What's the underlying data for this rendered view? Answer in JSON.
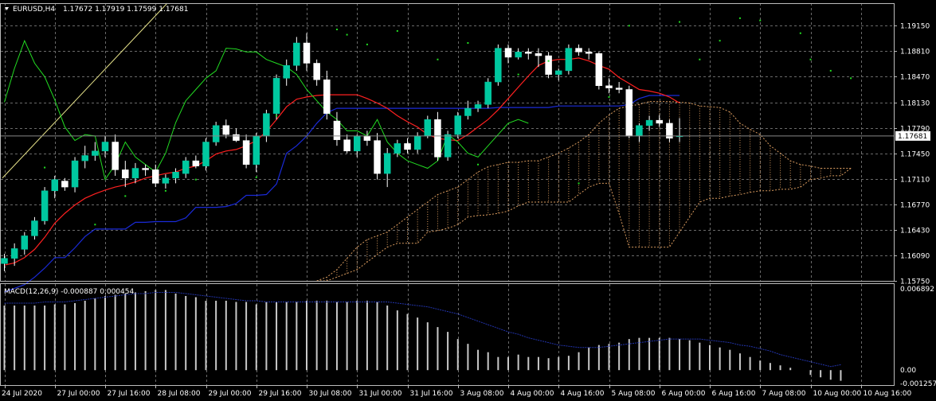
{
  "colors": {
    "background": "#000000",
    "grid": "#6a6a6a",
    "text": "#ffffff",
    "bull": "#00c8a0",
    "bear": "#ffffff",
    "tenkan": "#ff2020",
    "kijun": "#1a2ad8",
    "chikou": "#22dd22",
    "cloud": "#d89a5e",
    "trendline": "#e6e28a",
    "macd_hist": "#c8c8c8",
    "macd_signal": "#2233aa",
    "price_marker_bg": "#ffffff",
    "price_marker_text": "#000000"
  },
  "main_header": {
    "symbol": "EURUSD,H4",
    "ohlc": "1.17672 1.17919 1.17599 1.17681"
  },
  "macd_header": {
    "label": "MACD(12,26,9) -0.000887 0.000454"
  },
  "current_price_label": "1.17681",
  "chart_data": [
    {
      "type": "candlestick",
      "ylim": [
        1.1575,
        1.1945
      ],
      "y_ticks": [
        "1.19150",
        "1.18810",
        "1.18470",
        "1.18130",
        "1.17790",
        "1.17450",
        "1.17110",
        "1.16770",
        "1.16430",
        "1.16090",
        "1.15750"
      ],
      "y_tick_values": [
        1.1915,
        1.1881,
        1.1847,
        1.1813,
        1.1779,
        1.1745,
        1.1711,
        1.1677,
        1.1643,
        1.1609,
        1.1575
      ],
      "x_labels": [
        "24 Jul 2020",
        "27 Jul 00:00",
        "27 Jul 16:00",
        "28 Jul 08:00",
        "29 Jul 00:00",
        "29 Jul 16:00",
        "30 Jul 08:00",
        "31 Jul 00:00",
        "31 Jul 16:00",
        "3 Aug 08:00",
        "4 Aug 00:00",
        "4 Aug 16:00",
        "5 Aug 08:00",
        "6 Aug 00:00",
        "6 Aug 16:00",
        "7 Aug 08:00",
        "10 Aug 00:00",
        "10 Aug 16:00"
      ],
      "x_label_bars": [
        0,
        5,
        10,
        15,
        20,
        25,
        30,
        35,
        40,
        45,
        50,
        55,
        60,
        65,
        70,
        75,
        80,
        85
      ],
      "current_price": 1.17681,
      "candles": [
        {
          "o": 1.1598,
          "h": 1.1611,
          "l": 1.1588,
          "c": 1.1605
        },
        {
          "o": 1.1605,
          "h": 1.1625,
          "l": 1.1595,
          "c": 1.1618
        },
        {
          "o": 1.1617,
          "h": 1.164,
          "l": 1.161,
          "c": 1.1635
        },
        {
          "o": 1.1635,
          "h": 1.166,
          "l": 1.163,
          "c": 1.1655
        },
        {
          "o": 1.1655,
          "h": 1.17,
          "l": 1.165,
          "c": 1.1695
        },
        {
          "o": 1.1695,
          "h": 1.1715,
          "l": 1.1685,
          "c": 1.171
        },
        {
          "o": 1.1708,
          "h": 1.1712,
          "l": 1.1695,
          "c": 1.17
        },
        {
          "o": 1.17,
          "h": 1.174,
          "l": 1.1693,
          "c": 1.1735
        },
        {
          "o": 1.1735,
          "h": 1.1755,
          "l": 1.1725,
          "c": 1.1742
        },
        {
          "o": 1.1742,
          "h": 1.176,
          "l": 1.1735,
          "c": 1.1748
        },
        {
          "o": 1.1748,
          "h": 1.1768,
          "l": 1.174,
          "c": 1.176
        },
        {
          "o": 1.176,
          "h": 1.177,
          "l": 1.1715,
          "c": 1.1723
        },
        {
          "o": 1.1723,
          "h": 1.1735,
          "l": 1.17,
          "c": 1.1712
        },
        {
          "o": 1.1712,
          "h": 1.1732,
          "l": 1.1705,
          "c": 1.1725
        },
        {
          "o": 1.1725,
          "h": 1.173,
          "l": 1.1715,
          "c": 1.1723
        },
        {
          "o": 1.1723,
          "h": 1.173,
          "l": 1.17,
          "c": 1.1705
        },
        {
          "o": 1.1705,
          "h": 1.1717,
          "l": 1.1698,
          "c": 1.1712
        },
        {
          "o": 1.1712,
          "h": 1.1725,
          "l": 1.1705,
          "c": 1.172
        },
        {
          "o": 1.1718,
          "h": 1.174,
          "l": 1.1712,
          "c": 1.1735
        },
        {
          "o": 1.1735,
          "h": 1.1742,
          "l": 1.1725,
          "c": 1.1728
        },
        {
          "o": 1.1728,
          "h": 1.1765,
          "l": 1.1722,
          "c": 1.176
        },
        {
          "o": 1.176,
          "h": 1.1787,
          "l": 1.1755,
          "c": 1.1782
        },
        {
          "o": 1.1782,
          "h": 1.179,
          "l": 1.1765,
          "c": 1.177
        },
        {
          "o": 1.177,
          "h": 1.1778,
          "l": 1.176,
          "c": 1.1762
        },
        {
          "o": 1.1762,
          "h": 1.177,
          "l": 1.1725,
          "c": 1.173
        },
        {
          "o": 1.173,
          "h": 1.1772,
          "l": 1.172,
          "c": 1.1768
        },
        {
          "o": 1.1768,
          "h": 1.1803,
          "l": 1.176,
          "c": 1.1798
        },
        {
          "o": 1.1798,
          "h": 1.185,
          "l": 1.179,
          "c": 1.1845
        },
        {
          "o": 1.1845,
          "h": 1.187,
          "l": 1.1835,
          "c": 1.1862
        },
        {
          "o": 1.1862,
          "h": 1.19,
          "l": 1.1855,
          "c": 1.1892
        },
        {
          "o": 1.1892,
          "h": 1.1905,
          "l": 1.1855,
          "c": 1.1865
        },
        {
          "o": 1.1865,
          "h": 1.187,
          "l": 1.1835,
          "c": 1.1843
        },
        {
          "o": 1.1843,
          "h": 1.1855,
          "l": 1.179,
          "c": 1.1798
        },
        {
          "o": 1.1788,
          "h": 1.18,
          "l": 1.1755,
          "c": 1.1763
        },
        {
          "o": 1.1763,
          "h": 1.177,
          "l": 1.1745,
          "c": 1.1748
        },
        {
          "o": 1.1748,
          "h": 1.177,
          "l": 1.174,
          "c": 1.1768
        },
        {
          "o": 1.1768,
          "h": 1.1775,
          "l": 1.1755,
          "c": 1.1762
        },
        {
          "o": 1.1762,
          "h": 1.1772,
          "l": 1.171,
          "c": 1.1718
        },
        {
          "o": 1.1718,
          "h": 1.1752,
          "l": 1.17,
          "c": 1.1745
        },
        {
          "o": 1.1745,
          "h": 1.1763,
          "l": 1.174,
          "c": 1.1758
        },
        {
          "o": 1.1758,
          "h": 1.1765,
          "l": 1.1745,
          "c": 1.175
        },
        {
          "o": 1.175,
          "h": 1.1773,
          "l": 1.1745,
          "c": 1.1768
        },
        {
          "o": 1.1768,
          "h": 1.1795,
          "l": 1.1765,
          "c": 1.179
        },
        {
          "o": 1.179,
          "h": 1.18,
          "l": 1.1735,
          "c": 1.174
        },
        {
          "o": 1.174,
          "h": 1.1775,
          "l": 1.1735,
          "c": 1.177
        },
        {
          "o": 1.177,
          "h": 1.18,
          "l": 1.1765,
          "c": 1.1795
        },
        {
          "o": 1.1795,
          "h": 1.1815,
          "l": 1.179,
          "c": 1.1805
        },
        {
          "o": 1.1805,
          "h": 1.1815,
          "l": 1.18,
          "c": 1.181
        },
        {
          "o": 1.181,
          "h": 1.1845,
          "l": 1.1805,
          "c": 1.184
        },
        {
          "o": 1.184,
          "h": 1.189,
          "l": 1.1835,
          "c": 1.1885
        },
        {
          "o": 1.1885,
          "h": 1.189,
          "l": 1.1865,
          "c": 1.1873
        },
        {
          "o": 1.1873,
          "h": 1.1885,
          "l": 1.187,
          "c": 1.188
        },
        {
          "o": 1.188,
          "h": 1.1885,
          "l": 1.187,
          "c": 1.1878
        },
        {
          "o": 1.1878,
          "h": 1.1885,
          "l": 1.186,
          "c": 1.1875
        },
        {
          "o": 1.1875,
          "h": 1.188,
          "l": 1.1845,
          "c": 1.185
        },
        {
          "o": 1.185,
          "h": 1.1858,
          "l": 1.1842,
          "c": 1.1855
        },
        {
          "o": 1.1855,
          "h": 1.189,
          "l": 1.185,
          "c": 1.1885
        },
        {
          "o": 1.1885,
          "h": 1.189,
          "l": 1.1875,
          "c": 1.188
        },
        {
          "o": 1.188,
          "h": 1.1885,
          "l": 1.187,
          "c": 1.1878
        },
        {
          "o": 1.1878,
          "h": 1.188,
          "l": 1.183,
          "c": 1.1835
        },
        {
          "o": 1.1835,
          "h": 1.1845,
          "l": 1.1825,
          "c": 1.1832
        },
        {
          "o": 1.1832,
          "h": 1.184,
          "l": 1.1825,
          "c": 1.183
        },
        {
          "o": 1.183,
          "h": 1.1835,
          "l": 1.1765,
          "c": 1.1768
        },
        {
          "o": 1.1768,
          "h": 1.1785,
          "l": 1.176,
          "c": 1.1782
        },
        {
          "o": 1.1782,
          "h": 1.1795,
          "l": 1.1775,
          "c": 1.1789
        },
        {
          "o": 1.1789,
          "h": 1.1796,
          "l": 1.178,
          "c": 1.1785
        },
        {
          "o": 1.1785,
          "h": 1.179,
          "l": 1.176,
          "c": 1.1765
        },
        {
          "o": 1.17672,
          "h": 1.17919,
          "l": 1.17599,
          "c": 1.17681
        }
      ],
      "tenkan_sen": [
        1.1596,
        1.1599,
        1.1606,
        1.1617,
        1.1633,
        1.1652,
        1.1665,
        1.1676,
        1.1685,
        1.1691,
        1.1696,
        1.17,
        1.1703,
        1.1707,
        1.1712,
        1.1715,
        1.1718,
        1.172,
        1.1725,
        1.1728,
        1.1735,
        1.1744,
        1.1748,
        1.175,
        1.1755,
        1.1762,
        1.1774,
        1.179,
        1.1807,
        1.1817,
        1.182,
        1.1822,
        1.1823,
        1.1823,
        1.1823,
        1.1823,
        1.1818,
        1.1812,
        1.1805,
        1.1795,
        1.1787,
        1.178,
        1.177,
        1.1765,
        1.1763,
        1.1762,
        1.177,
        1.178,
        1.179,
        1.1803,
        1.1818,
        1.1833,
        1.1848,
        1.1862,
        1.1868,
        1.187,
        1.187,
        1.1872,
        1.1868,
        1.1862,
        1.1857,
        1.1846,
        1.1838,
        1.183,
        1.1828,
        1.1825,
        1.182,
        1.1812
      ],
      "kijun_sen": [
        1.156,
        1.1565,
        1.157,
        1.158,
        1.1592,
        1.1606,
        1.1606,
        1.1619,
        1.1634,
        1.1644,
        1.1644,
        1.1644,
        1.1644,
        1.1653,
        1.1653,
        1.1654,
        1.1654,
        1.1654,
        1.1659,
        1.1673,
        1.1673,
        1.1673,
        1.1674,
        1.1678,
        1.1689,
        1.1689,
        1.169,
        1.1704,
        1.1745,
        1.1755,
        1.1768,
        1.1785,
        1.1799,
        1.1805,
        1.1805,
        1.1805,
        1.1805,
        1.1805,
        1.1805,
        1.1805,
        1.1805,
        1.1805,
        1.1805,
        1.1805,
        1.1805,
        1.1805,
        1.1805,
        1.1805,
        1.1805,
        1.1806,
        1.1806,
        1.1806,
        1.1806,
        1.1806,
        1.1806,
        1.1808,
        1.1808,
        1.1808,
        1.1808,
        1.1808,
        1.1808,
        1.1808,
        1.181,
        1.1818,
        1.1822,
        1.1822,
        1.1822,
        1.1822
      ],
      "chikou_span": [
        1.1813,
        1.1858,
        1.1895,
        1.1865,
        1.1847,
        1.1816,
        1.178,
        1.1762,
        1.177,
        1.1768,
        1.171,
        1.173,
        1.176,
        1.174,
        1.173,
        1.172,
        1.1745,
        1.1786,
        1.1815,
        1.183,
        1.1845,
        1.1855,
        1.1885,
        1.1884,
        1.188,
        1.188,
        1.187,
        1.1865,
        1.186,
        1.185,
        1.183,
        1.1815,
        1.18,
        1.179,
        1.1775,
        1.1775,
        1.1768,
        1.179,
        1.176,
        1.1745,
        1.1735,
        1.173,
        1.1725,
        1.1735,
        1.177,
        1.176,
        1.1745,
        1.174,
        1.1755,
        1.177,
        1.1785,
        1.179,
        1.1785
      ],
      "senkou_span_a": [
        null,
        null,
        null,
        null,
        null,
        null,
        null,
        null,
        null,
        null,
        null,
        null,
        null,
        null,
        null,
        null,
        null,
        null,
        null,
        null,
        null,
        null,
        null,
        null,
        null,
        null,
        null,
        null,
        null,
        null,
        null,
        1.1575,
        1.158,
        1.159,
        1.1605,
        1.162,
        1.163,
        1.1635,
        1.164,
        1.165,
        1.166,
        1.167,
        1.168,
        1.169,
        1.1695,
        1.17,
        1.171,
        1.172,
        1.1727,
        1.173,
        1.1733,
        1.1733,
        1.1735,
        1.1735,
        1.174,
        1.1745,
        1.1752,
        1.176,
        1.177,
        1.1785,
        1.1796,
        1.1805,
        1.1808,
        1.181,
        1.1814,
        1.1814,
        1.1814,
        1.1813,
        1.1812,
        1.1808,
        1.1807,
        1.1806,
        1.18,
        1.1785,
        1.1777,
        1.177,
        1.1755,
        1.1745,
        1.1735,
        1.173,
        1.1728,
        1.1725,
        1.1725,
        1.1725,
        1.1725
      ],
      "senkou_span_b": [
        null,
        null,
        null,
        null,
        null,
        null,
        null,
        null,
        null,
        null,
        null,
        null,
        null,
        null,
        null,
        null,
        null,
        null,
        null,
        null,
        null,
        null,
        null,
        null,
        null,
        null,
        null,
        null,
        null,
        null,
        null,
        1.1575,
        1.1575,
        1.158,
        1.1585,
        1.159,
        1.16,
        1.161,
        1.162,
        1.1625,
        1.1625,
        1.1625,
        1.164,
        1.1642,
        1.1645,
        1.165,
        1.166,
        1.1662,
        1.1663,
        1.1665,
        1.1668,
        1.1675,
        1.168,
        1.168,
        1.168,
        1.168,
        1.168,
        1.169,
        1.17,
        1.1705,
        1.1705,
        1.1665,
        1.162,
        1.162,
        1.162,
        1.162,
        1.162,
        1.164,
        1.166,
        1.168,
        1.1685,
        1.1685,
        1.1688,
        1.169,
        1.1693,
        1.1695,
        1.1695,
        1.1697,
        1.1697,
        1.17,
        1.171,
        1.1712,
        1.1715,
        1.1715,
        1.1725
      ],
      "fractals": [
        {
          "i": 4,
          "v": 1.1726
        },
        {
          "i": 9,
          "v": 1.165
        },
        {
          "i": 12,
          "v": 1.1688
        },
        {
          "i": 16,
          "v": 1.1695
        },
        {
          "i": 19,
          "v": 1.171
        },
        {
          "i": 25,
          "v": 1.1713
        },
        {
          "i": 27,
          "v": 1.1795
        },
        {
          "i": 33,
          "v": 1.191
        },
        {
          "i": 34,
          "v": 1.1903
        },
        {
          "i": 36,
          "v": 1.189
        },
        {
          "i": 39,
          "v": 1.1908
        },
        {
          "i": 43,
          "v": 1.187
        },
        {
          "i": 46,
          "v": 1.1892
        },
        {
          "i": 47,
          "v": 1.173
        },
        {
          "i": 51,
          "v": 1.185
        },
        {
          "i": 54,
          "v": 1.1868
        },
        {
          "i": 57,
          "v": 1.1705
        },
        {
          "i": 60,
          "v": 1.182
        },
        {
          "i": 62,
          "v": 1.1915
        },
        {
          "i": 67,
          "v": 1.192
        },
        {
          "i": 69,
          "v": 1.187
        },
        {
          "i": 71,
          "v": 1.1895
        },
        {
          "i": 73,
          "v": 1.1925
        },
        {
          "i": 75,
          "v": 1.1922
        },
        {
          "i": 79,
          "v": 1.1905
        },
        {
          "i": 80,
          "v": 1.187
        },
        {
          "i": 82,
          "v": 1.1855
        },
        {
          "i": 84,
          "v": 1.1845
        }
      ]
    },
    {
      "type": "bar",
      "name": "MACD(12,26,9)",
      "ylim": [
        -0.00125,
        0.0072
      ],
      "y_ticks": [
        "0.006892",
        "0.00",
        "-0.001257"
      ],
      "y_tick_values": [
        0.006892,
        0.0,
        -0.001257
      ],
      "macd_histogram": [
        0.0054,
        0.0054,
        0.0054,
        0.0054,
        0.0054,
        0.0055,
        0.0055,
        0.0056,
        0.0058,
        0.006,
        0.0062,
        0.0063,
        0.0064,
        0.0065,
        0.0066,
        0.0067,
        0.0067,
        0.0064,
        0.0062,
        0.0061,
        0.0058,
        0.0058,
        0.0058,
        0.0057,
        0.0057,
        0.0055,
        0.0057,
        0.0057,
        0.0057,
        0.0057,
        0.0058,
        0.0058,
        0.0058,
        0.0057,
        0.0057,
        0.0058,
        0.0058,
        0.0057,
        0.0054,
        0.005,
        0.0047,
        0.0044,
        0.004,
        0.0036,
        0.0032,
        0.0026,
        0.0022,
        0.0017,
        0.0015,
        0.0011,
        0.0011,
        0.0013,
        0.0011,
        0.0011,
        0.001,
        0.0011,
        0.0012,
        0.0015,
        0.0019,
        0.0021,
        0.0022,
        0.0023,
        0.0026,
        0.0027,
        0.0027,
        0.0027,
        0.0027,
        0.0026,
        0.0025,
        0.0023,
        0.0021,
        0.0019,
        0.0017,
        0.0014,
        0.0011,
        0.0008,
        0.0006,
        0.0004,
        0.0002,
        0.0,
        -0.0004,
        -0.0006,
        -0.0008,
        -0.00089
      ],
      "signal_line": [
        0.0056,
        0.0056,
        0.0056,
        0.0056,
        0.0057,
        0.0057,
        0.0057,
        0.0058,
        0.0059,
        0.006,
        0.0061,
        0.0062,
        0.0063,
        0.0064,
        0.0064,
        0.0065,
        0.0065,
        0.0065,
        0.0064,
        0.0063,
        0.0062,
        0.0061,
        0.006,
        0.0059,
        0.0058,
        0.0058,
        0.0057,
        0.0057,
        0.0057,
        0.0057,
        0.0057,
        0.0057,
        0.0057,
        0.0057,
        0.0057,
        0.0057,
        0.0057,
        0.0057,
        0.0057,
        0.0056,
        0.0055,
        0.0054,
        0.0053,
        0.0051,
        0.0049,
        0.0047,
        0.0044,
        0.0041,
        0.0038,
        0.0035,
        0.0032,
        0.003,
        0.0027,
        0.0025,
        0.0023,
        0.0021,
        0.002,
        0.0019,
        0.0019,
        0.0019,
        0.002,
        0.0021,
        0.0022,
        0.0023,
        0.0024,
        0.0025,
        0.0026,
        0.0026,
        0.0026,
        0.0026,
        0.0025,
        0.0024,
        0.0023,
        0.0021,
        0.002,
        0.0018,
        0.0016,
        0.0013,
        0.0011,
        0.0009,
        0.0007,
        0.0005,
        0.0003,
        0.00045
      ]
    }
  ]
}
